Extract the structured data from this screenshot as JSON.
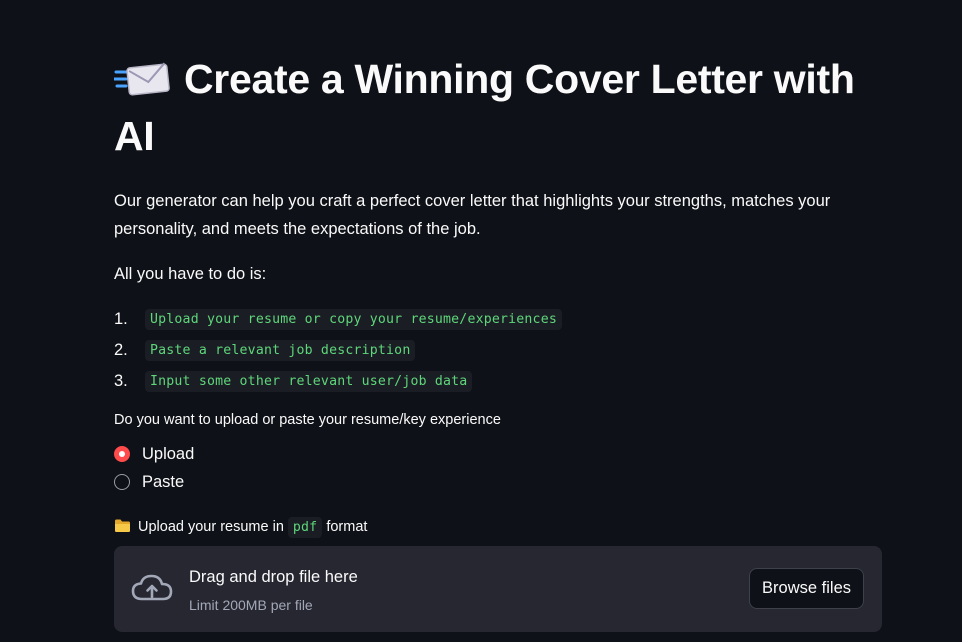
{
  "header": {
    "icon": "incoming-envelope-icon",
    "title": "Create a Winning Cover Letter with AI"
  },
  "intro": {
    "text": "Our generator can help you craft a perfect cover letter that highlights your strengths, matches your personality, and meets the expectations of the job.",
    "lead": "All you have to do is:"
  },
  "steps": [
    {
      "num": "1.",
      "text": "Upload your resume or copy your resume/experiences"
    },
    {
      "num": "2.",
      "text": "Paste a relevant job description"
    },
    {
      "num": "3.",
      "text": "Input some other relevant user/job data"
    }
  ],
  "resume_mode": {
    "label": "Do you want to upload or paste your resume/key experience",
    "options": [
      "Upload",
      "Paste"
    ],
    "selected": "Upload"
  },
  "uploader": {
    "icon": "folder-icon",
    "label_before": "Upload your resume in",
    "label_code": "pdf",
    "label_after": "format",
    "drop_title": "Drag and drop file here",
    "limit": "Limit 200MB per file",
    "browse_label": "Browse files",
    "upload_icon": "cloud-upload-icon"
  },
  "colors": {
    "background": "#0e1117",
    "accent": "#ff4b4b",
    "code_text": "#5ed67a",
    "dropzone": "#262730"
  }
}
